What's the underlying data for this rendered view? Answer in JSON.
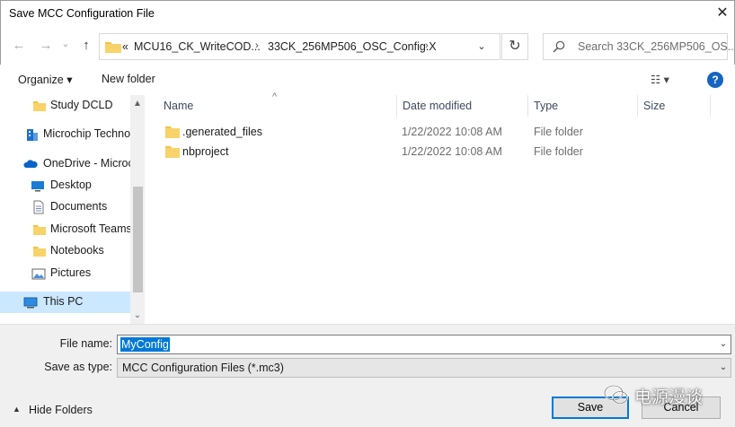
{
  "window": {
    "title": "Save MCC Configuration File",
    "close_glyph": "✕"
  },
  "nav": {
    "back_glyph": "←",
    "forward_glyph": "→",
    "recent_glyph": "⌄",
    "up_glyph": "↑",
    "address": {
      "overflow": "«",
      "crumbs": [
        "MCU16_CK_WriteCOD...",
        "33CK_256MP506_OSC_Config.X"
      ],
      "sep": "›",
      "dropdown_glyph": "⌄"
    },
    "refresh_glyph": "↻",
    "search_placeholder": "Search 33CK_256MP506_OS..."
  },
  "toolbar": {
    "organize": "Organize ▾",
    "new_folder": "New folder",
    "view_glyph": "☷ ▾",
    "help": "?"
  },
  "sidebar": {
    "items": [
      {
        "label": "Study DCLD",
        "icon": "folder-icon"
      },
      {
        "label": "Microchip Techno",
        "icon": "building-icon"
      },
      {
        "label": "OneDrive - Microc",
        "icon": "cloud-icon"
      },
      {
        "label": "Desktop",
        "icon": "desktop-icon"
      },
      {
        "label": "Documents",
        "icon": "document-icon"
      },
      {
        "label": "Microsoft Teams",
        "icon": "folder-icon"
      },
      {
        "label": "Notebooks",
        "icon": "folder-icon"
      },
      {
        "label": "Pictures",
        "icon": "pictures-icon"
      },
      {
        "label": "This PC",
        "icon": "computer-icon"
      }
    ],
    "scroll_up": "▲",
    "scroll_down": "⌄"
  },
  "files": {
    "sort_glyph": "^",
    "columns": {
      "name": "Name",
      "date": "Date modified",
      "type": "Type",
      "size": "Size"
    },
    "rows": [
      {
        "name": ".generated_files",
        "date": "1/22/2022 10:08 AM",
        "type": "File folder"
      },
      {
        "name": "nbproject",
        "date": "1/22/2022 10:08 AM",
        "type": "File folder"
      }
    ]
  },
  "form": {
    "file_name_label": "File name:",
    "file_name_value": "MyConfig",
    "save_type_label": "Save as type:",
    "save_type_value": "MCC Configuration Files (*.mc3)",
    "dropdown_glyph": "⌄"
  },
  "footer": {
    "hide_folders": "Hide Folders",
    "hide_glyph": "▲",
    "save": "Save",
    "cancel": "Cancel"
  },
  "watermark": "电源漫谈",
  "colors": {
    "accent": "#0078d7",
    "folder": "#f5c342",
    "selection": "#cce8ff",
    "help": "#1565c0"
  }
}
